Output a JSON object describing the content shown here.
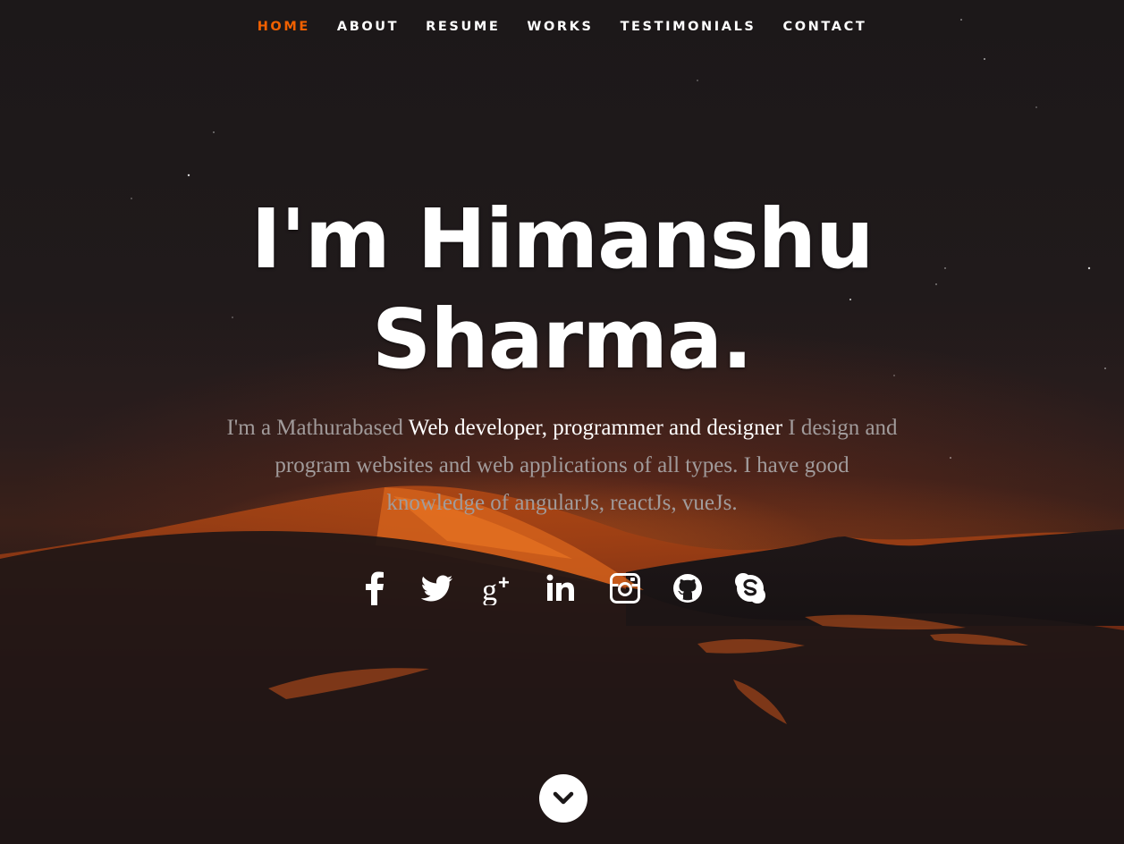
{
  "nav": {
    "items": [
      {
        "label": "HOME",
        "active": true
      },
      {
        "label": "ABOUT",
        "active": false
      },
      {
        "label": "RESUME",
        "active": false
      },
      {
        "label": "WORKS",
        "active": false
      },
      {
        "label": "TESTIMONIALS",
        "active": false
      },
      {
        "label": "CONTACT",
        "active": false
      }
    ],
    "active_color": "#f06000"
  },
  "hero": {
    "headline_line1": "I'm Himanshu",
    "headline_line2": "Sharma.",
    "intro_before": "I'm a Mathurabased ",
    "intro_highlight": "Web developer, programmer and designer",
    "intro_after": " I design and program websites and web applications of all types. I have good knowledge of angularJs, reactJs, vueJs."
  },
  "social": [
    {
      "icon": "facebook-icon"
    },
    {
      "icon": "twitter-icon"
    },
    {
      "icon": "google-plus-icon"
    },
    {
      "icon": "linkedin-icon"
    },
    {
      "icon": "instagram-icon"
    },
    {
      "icon": "github-icon"
    },
    {
      "icon": "skype-icon"
    }
  ],
  "scroll_down": {
    "icon": "chevron-down-icon"
  },
  "colors": {
    "background": "#1b1718",
    "accent": "#f06000",
    "text": "#ffffff",
    "muted_text": "#a19b9b"
  }
}
